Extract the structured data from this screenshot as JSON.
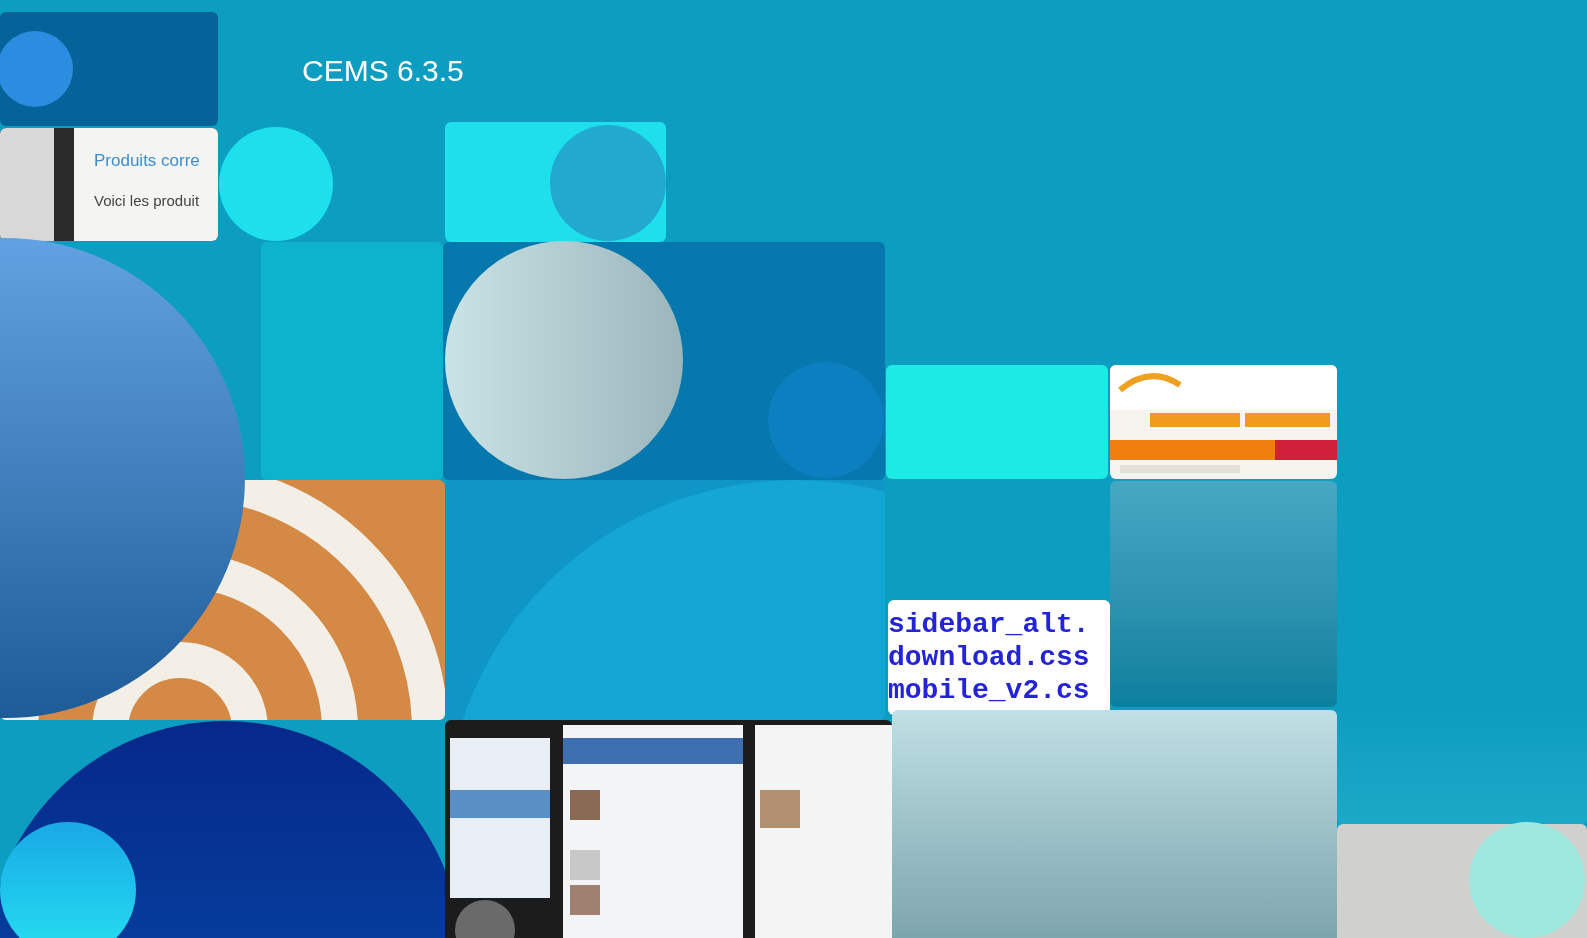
{
  "version_label": "CEMS 6.3.5",
  "tiles": [
    {
      "kind": "shop",
      "title": "Produits corre",
      "text": "Voici les produit"
    },
    {
      "kind": "code",
      "lines": [
        "sidebar_alt.",
        "download.css",
        "mobile_v2.cs"
      ]
    }
  ]
}
